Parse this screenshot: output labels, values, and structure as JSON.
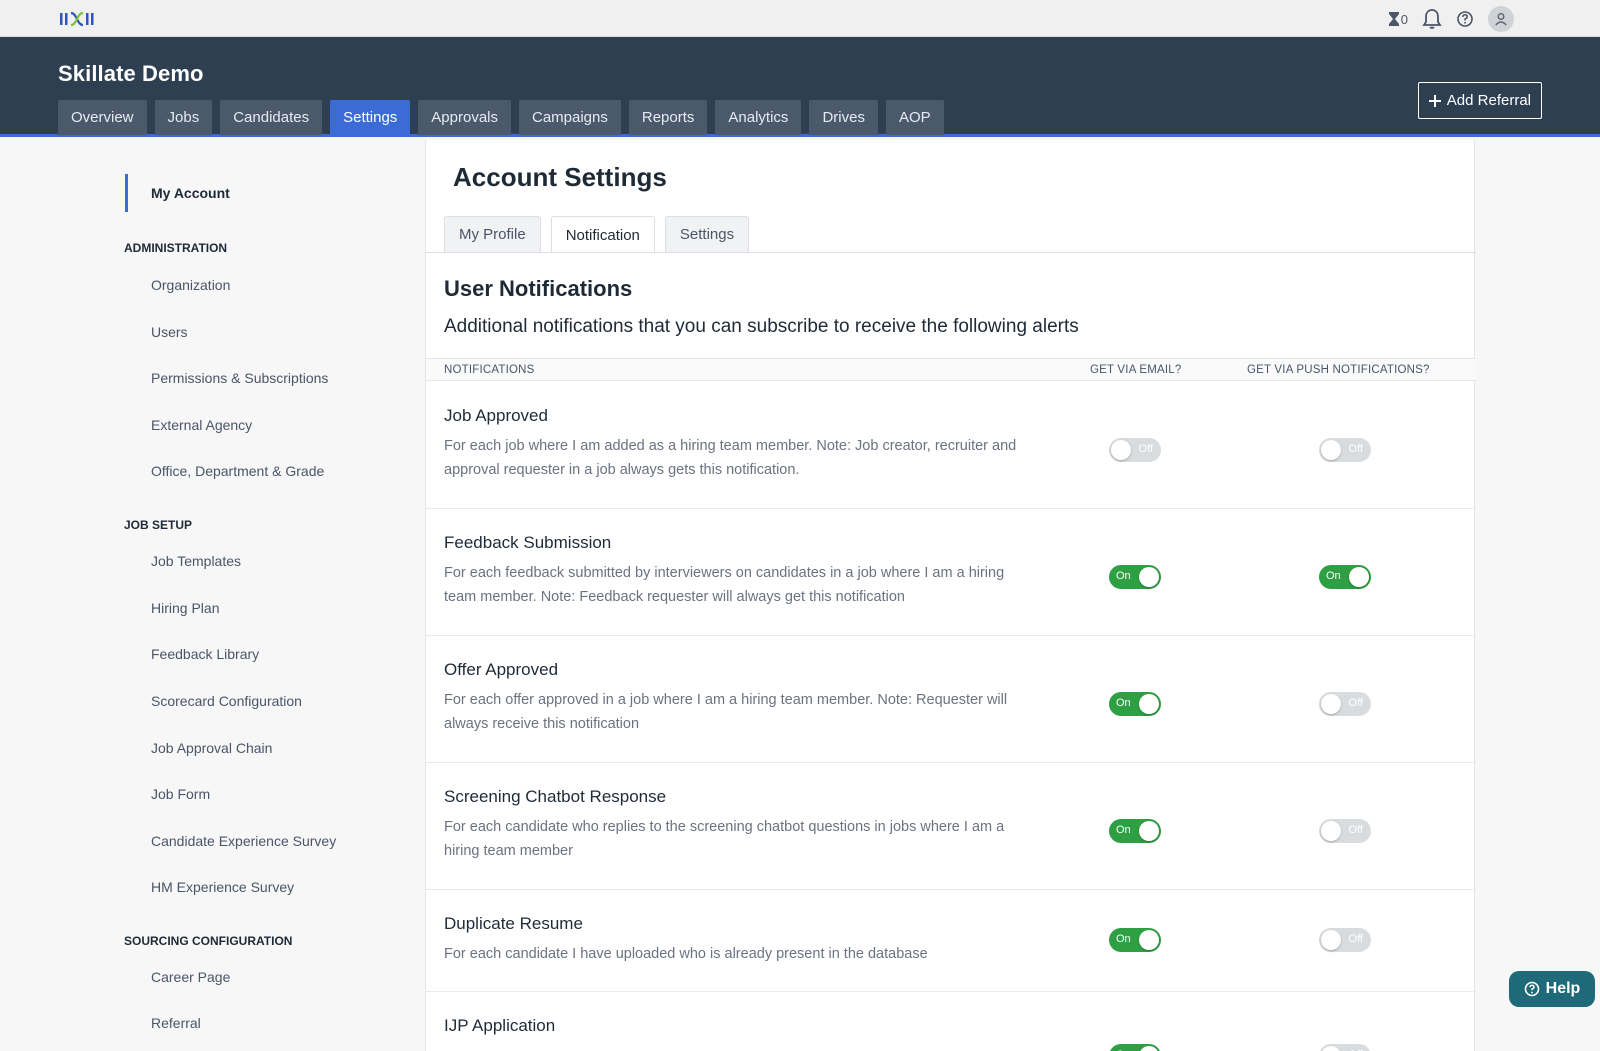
{
  "topbar": {
    "hourglass_count": "0"
  },
  "header": {
    "title": "Skillate Demo",
    "nav": [
      "Overview",
      "Jobs",
      "Candidates",
      "Settings",
      "Approvals",
      "Campaigns",
      "Reports",
      "Analytics",
      "Drives",
      "AOP"
    ],
    "active_nav": "Settings",
    "add_referral_label": "Add Referral"
  },
  "sidebar": {
    "my_account": "My Account",
    "administration_heading": "ADMINISTRATION",
    "administration": [
      "Organization",
      "Users",
      "Permissions & Subscriptions",
      "External Agency",
      "Office, Department & Grade"
    ],
    "job_setup_heading": "JOB SETUP",
    "job_setup": [
      "Job Templates",
      "Hiring Plan",
      "Feedback Library",
      "Scorecard Configuration",
      "Job Approval Chain",
      "Job Form",
      "Candidate Experience Survey",
      "HM Experience Survey"
    ],
    "sourcing_heading": "SOURCING CONFIGURATION",
    "sourcing": [
      "Career Page",
      "Referral"
    ]
  },
  "main": {
    "title": "Account Settings",
    "tabs": [
      "My Profile",
      "Notification",
      "Settings"
    ],
    "active_tab": "Notification",
    "section_title": "User Notifications",
    "section_desc": "Additional notifications that you can subscribe to receive the following alerts",
    "columns": {
      "notifications": "NOTIFICATIONS",
      "email": "GET VIA EMAIL?",
      "push": "GET VIA PUSH NOTIFICATIONS?"
    },
    "toggle_on_label": "On",
    "toggle_off_label": "Off",
    "rows": [
      {
        "title": "Job Approved",
        "desc": "For each job where I am added as a hiring team member. Note: Job creator, recruiter and approval requester in a job always gets this notification.",
        "email": false,
        "push": false
      },
      {
        "title": "Feedback Submission",
        "desc": "For each feedback submitted by interviewers on candidates in a job where I am a hiring team member. Note: Feedback requester will always get this notification",
        "email": true,
        "push": true
      },
      {
        "title": "Offer Approved",
        "desc": "For each offer approved in a job where I am a hiring team member. Note: Requester will always receive this notification",
        "email": true,
        "push": false
      },
      {
        "title": "Screening Chatbot Response",
        "desc": "For each candidate who replies to the screening chatbot questions in jobs where I am a hiring team member",
        "email": true,
        "push": false
      },
      {
        "title": "Duplicate Resume",
        "desc": "For each candidate I have uploaded who is already present in the database",
        "email": true,
        "push": false
      },
      {
        "title": "IJP Application",
        "desc": "",
        "email": true,
        "push": false
      }
    ]
  },
  "help_label": "Help",
  "colors": {
    "header_bg": "#2f3f52",
    "accent": "#3a6bd6",
    "toggle_on": "#2ea043",
    "toggle_off": "#d9dcdf"
  }
}
